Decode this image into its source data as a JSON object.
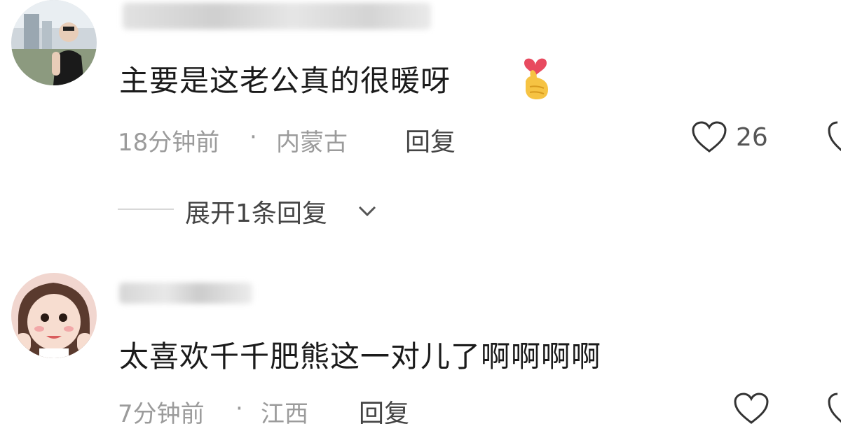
{
  "comments": [
    {
      "text": "主要是这老公真的很暖呀",
      "time": "18分钟前",
      "separator": "·",
      "location": "内蒙古",
      "reply_label": "回复",
      "like_count": "26",
      "expand_label": "展开1条回复",
      "emoji": "finger-heart-emoji"
    },
    {
      "text": "太喜欢千千肥熊这一对儿了啊啊啊啊",
      "time": "7分钟前",
      "separator": "·",
      "location": "江西",
      "reply_label": "回复"
    }
  ],
  "icons": {
    "like": "heart-outline-icon",
    "expand": "chevron-down-icon"
  },
  "colors": {
    "text": "#1b1b1b",
    "meta": "#9b9b9b",
    "action": "#444444"
  }
}
